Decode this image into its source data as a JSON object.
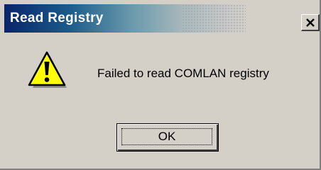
{
  "window": {
    "title": "Read Registry",
    "title_color": "#0a246a"
  },
  "message": {
    "text": "Failed to read COMLAN registry",
    "icon": "warning-icon"
  },
  "buttons": {
    "ok_label": "OK",
    "close_icon": "close-icon"
  },
  "colors": {
    "dialog_face": "#d4d0c8",
    "warning_yellow": "#ffff00"
  }
}
